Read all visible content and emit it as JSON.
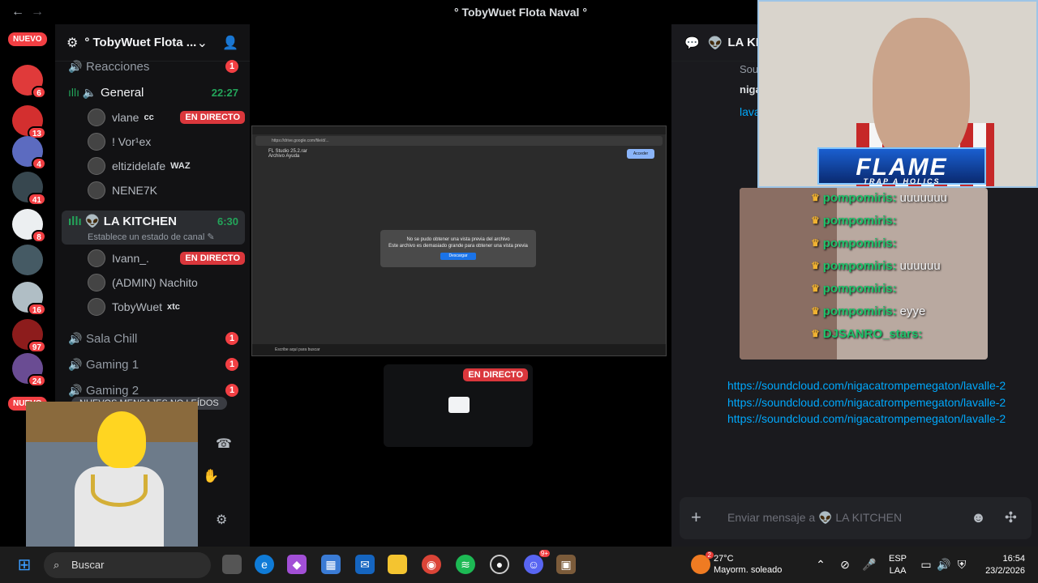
{
  "window": {
    "title": "° TobyWuet Flota Naval °",
    "back_icon": "arrow-left-icon",
    "forward_icon": "arrow-right-icon"
  },
  "rail": {
    "nuevo_top": "NUEVO",
    "nuevo_bottom": "NUEVO",
    "servers": [
      {
        "badge": "6",
        "color": "#e03a3a"
      },
      {
        "badge": "13",
        "color": "#d32f2f"
      },
      {
        "badge": "4",
        "color": "#5c6bc0"
      },
      {
        "badge": "41",
        "color": "#37474f"
      },
      {
        "badge": "8",
        "color": "#eceff1"
      },
      {
        "badge": "",
        "color": "#455a64"
      },
      {
        "badge": "16",
        "color": "#b0bec5"
      },
      {
        "badge": "97",
        "color": "#8d1c1c"
      },
      {
        "badge": "24",
        "color": "#6a4c93"
      }
    ]
  },
  "server": {
    "name": "° TobyWuet Flota ...",
    "channels": {
      "reacciones": {
        "label": "Reacciones",
        "count": "1"
      },
      "general": {
        "label": "General",
        "time": "22:27"
      },
      "kitchen": {
        "label": "LA KITCHEN",
        "time": "6:30",
        "status": "Establece un estado de canal"
      },
      "sala_chill": {
        "label": "Sala Chill",
        "count": "1"
      },
      "gaming1": {
        "label": "Gaming 1",
        "count": "1"
      },
      "gaming2": {
        "label": "Gaming 2",
        "count": "1"
      }
    },
    "general_users": [
      {
        "name": "vlane",
        "tag": "cc",
        "live": "EN DIRECTO"
      },
      {
        "name": "! Vor¹ex",
        "tag": "",
        "live": ""
      },
      {
        "name": "eltizidelafe",
        "tag": "WAZ",
        "live": ""
      },
      {
        "name": "NENE7K",
        "tag": "",
        "live": ""
      }
    ],
    "kitchen_users": [
      {
        "name": "Ivann_.",
        "tag": "",
        "live": "EN DIRECTO"
      },
      {
        "name": "(ADMIN) Nachito",
        "tag": "",
        "live": ""
      },
      {
        "name": "TobyWuet",
        "tag": "xtc",
        "live": ""
      }
    ],
    "unread_banner": "NUEVOS MENSAJES NO LEÍDOS"
  },
  "stream": {
    "file_name": "FL Studio 25.2.rar",
    "file_menu": "Archivo    Ayuda",
    "access_btn": "Acceder",
    "dialog_line1": "No se pudo obtener una vista previa del archivo",
    "dialog_line2": "Este archivo es demasiado grande para obtener una vista previa",
    "dialog_btn": "Descargar",
    "mini_taskbar": "Escribe aquí para buscar",
    "address": "https://drive.google.com/file/d/...",
    "second_tile_live": "EN DIRECTO"
  },
  "chat": {
    "channel": "LA KITCHEN",
    "preview_sour": "Sour",
    "preview_niga": "niga",
    "preview_lava": "lava",
    "overlay_title": "FLAME",
    "overlay_sub": "TRAP A HOLICS",
    "messages": [
      {
        "user": "pompomiris:",
        "text": "uuuuuuu"
      },
      {
        "user": "pompomiris:",
        "text": ""
      },
      {
        "user": "pompomiris:",
        "text": ""
      },
      {
        "user": "pompomiris:",
        "text": "uuuuuu"
      },
      {
        "user": "pompomiris:",
        "text": ""
      },
      {
        "user": "pompomiris:",
        "text": "eyye"
      },
      {
        "user": "DJSANRO_stars:",
        "text": ""
      }
    ],
    "links": "https://soundcloud.com/nigacatrompemegaton/lavalle-2https://soundcloud.com/nigacatrompemegaton/lavalle-2https://soundcloud.com/nigacatrompemegaton/lavalle-2",
    "input_placeholder": "Enviar mensaje a 👽 LA KITCHEN"
  },
  "taskbar": {
    "search": "Buscar",
    "temp": "27°C",
    "weather": "Mayorm. soleado",
    "weather_badge": "2",
    "lang1": "ESP",
    "lang2": "LAA",
    "time": "16:54",
    "date": "23/2/2026",
    "discord_badge": "9+"
  }
}
